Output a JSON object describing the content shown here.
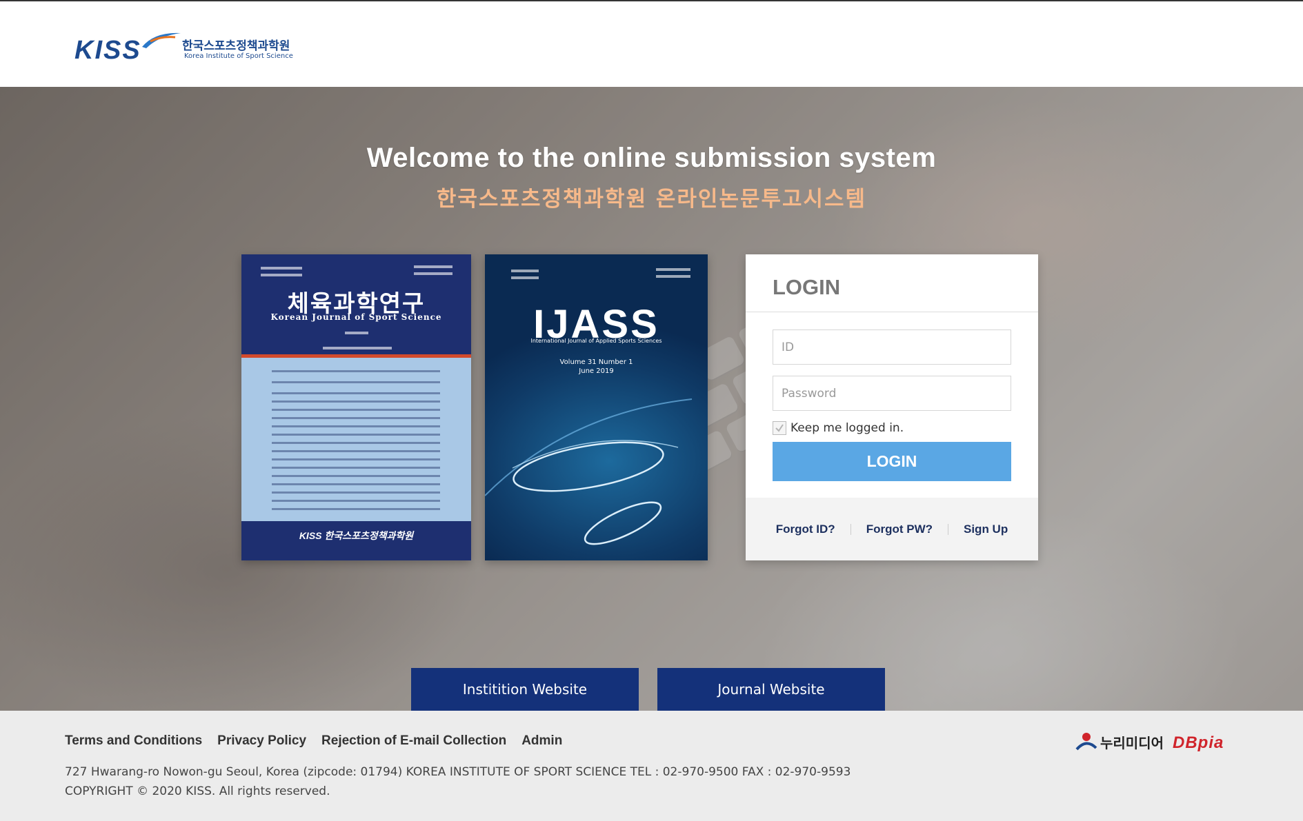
{
  "header": {
    "logo_kiss": "KISS",
    "logo_kr": "한국스포츠정책과학원",
    "logo_en": "Korea Institute of Sport Science"
  },
  "hero": {
    "welcome": "Welcome to the online submission system",
    "welcome_kr": "한국스포츠정책과학원 온라인논문투고시스템"
  },
  "journals": [
    {
      "title": "체육과학연구",
      "subtitle": "Korean Journal of Sport Science",
      "footer": "KISS 한국스포츠정책과학원"
    },
    {
      "title": "IJASS",
      "subtitle": "International Journal of Applied Sports Sciences",
      "volume": "Volume 31 Number 1",
      "date": "June 2019"
    }
  ],
  "login": {
    "title": "LOGIN",
    "id_placeholder": "ID",
    "password_placeholder": "Password",
    "keep_label": "Keep me logged in.",
    "button_label": "LOGIN",
    "forgot_id": "Forgot ID?",
    "forgot_pw": "Forgot PW?",
    "sign_up": "Sign Up"
  },
  "sites": {
    "institution": "Institition Website",
    "journal": "Journal Website"
  },
  "footer": {
    "links": [
      "Terms and Conditions",
      "Privacy Policy",
      "Rejection of E-mail Collection",
      "Admin"
    ],
    "address": "727 Hwarang-ro Nowon-gu Seoul, Korea (zipcode: 01794) KOREA INSTITUTE OF SPORT SCIENCE TEL : 02-970-9500 FAX : 02-970-9593",
    "copyright": "COPYRIGHT © 2020 KISS. All rights reserved.",
    "partner1": "누리미디어",
    "partner2": "DBpia"
  },
  "colors": {
    "navy": "#14317a",
    "login_button": "#5aa7e4",
    "subtitle_orange": "#f7b98a",
    "brand_blue": "#1d4a8f",
    "dbpia_red": "#d0242b"
  }
}
